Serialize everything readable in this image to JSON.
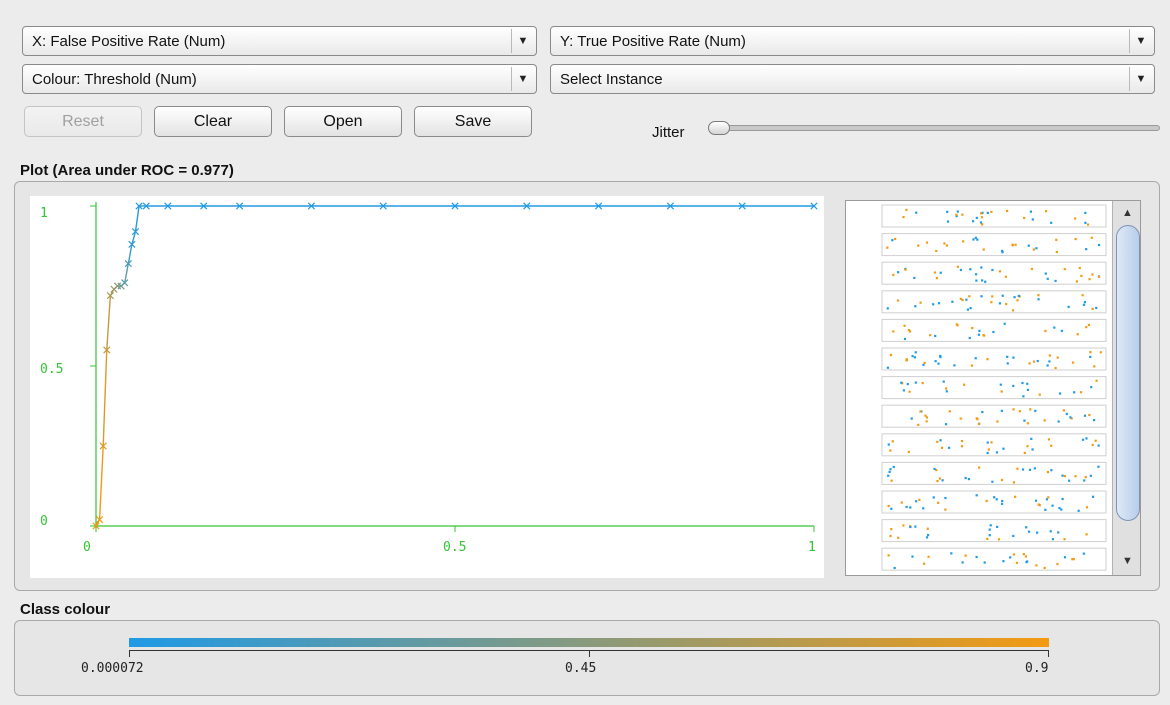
{
  "controls": {
    "x_axis_select": "X: False Positive Rate (Num)",
    "y_axis_select": "Y: True Positive Rate (Num)",
    "colour_select": "Colour: Threshold (Num)",
    "instance_select": "Select Instance",
    "reset_label": "Reset",
    "clear_label": "Clear",
    "open_label": "Open",
    "save_label": "Save",
    "jitter_label": "Jitter",
    "jitter_value": 0
  },
  "plot": {
    "title": "Plot (Area under ROC = 0.977)",
    "matrix_x_label": "X",
    "matrix_y_label": "Y"
  },
  "chart_data": {
    "type": "line",
    "title": "",
    "xlabel": "",
    "ylabel": "",
    "xlim": [
      0,
      1
    ],
    "ylim": [
      0,
      1
    ],
    "x_ticks": [
      "0",
      "0.5",
      "1"
    ],
    "y_ticks": [
      "0",
      "0.5",
      "1"
    ],
    "series": [
      {
        "x": [
          0,
          0.005,
          0.01,
          0.015,
          0.02,
          0.025,
          0.03,
          0.035,
          0.04,
          0.045,
          0.05,
          0.055,
          0.06,
          0.07,
          0.1,
          0.15,
          0.2,
          0.3,
          0.4,
          0.5,
          0.6,
          0.7,
          0.8,
          0.9,
          1.0
        ],
        "y": [
          0,
          0.02,
          0.25,
          0.55,
          0.72,
          0.74,
          0.75,
          0.75,
          0.76,
          0.82,
          0.88,
          0.92,
          1,
          1,
          1,
          1,
          1,
          1,
          1,
          1,
          1,
          1,
          1,
          1,
          1
        ],
        "threshold": [
          0.9,
          0.88,
          0.8,
          0.7,
          0.6,
          0.55,
          0.45,
          0.35,
          0.25,
          0.15,
          0.08,
          0.04,
          0.02,
          0.015,
          0.01,
          0.008,
          0.006,
          0.004,
          0.003,
          0.002,
          0.0015,
          0.001,
          0.0008,
          0.0004,
          7.2e-05
        ]
      }
    ],
    "grid": false
  },
  "legend": {
    "title": "Class colour",
    "min_label": "0.000072",
    "mid_label": "0.45",
    "max_label": "0.9",
    "color_low": "#1f9ae6",
    "color_high": "#f39a12"
  },
  "colors": {
    "axis": "#35c335",
    "low": "#1f9ae6",
    "high": "#f39a12"
  }
}
